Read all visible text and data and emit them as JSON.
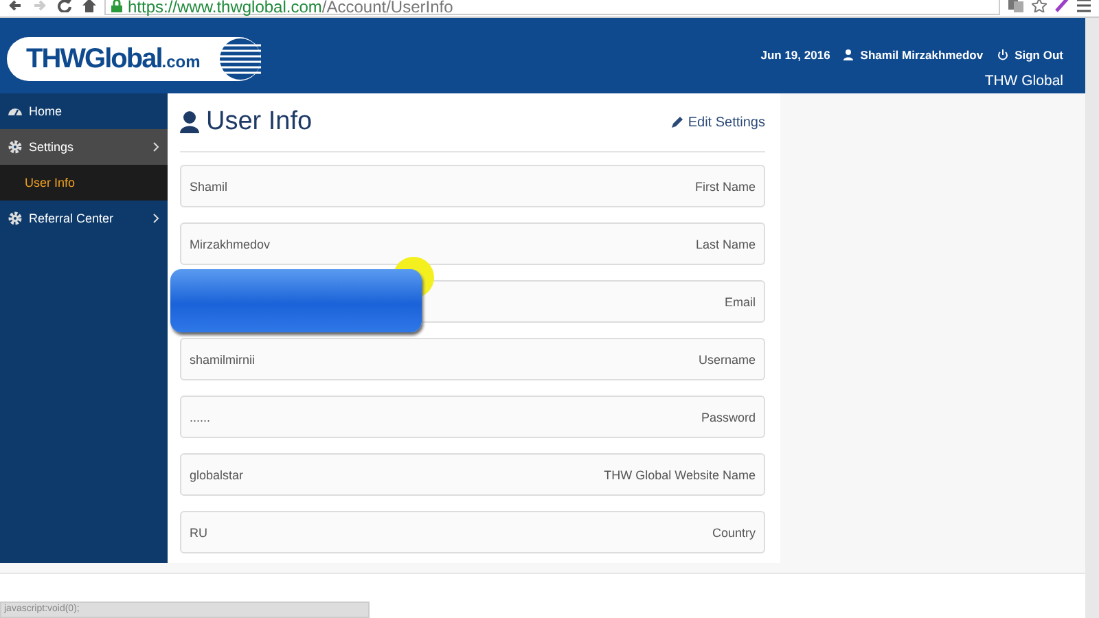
{
  "browser": {
    "url_host": "https://www.thwglobal.com",
    "url_path": "/Account/UserInfo",
    "forward_disabled": true
  },
  "header": {
    "logo": "THWGlobal",
    "logo_suffix": ".com",
    "date": "Jun 19, 2016",
    "user": "Shamil Mirzakhmedov",
    "sign_out": "Sign Out",
    "site_name": "THW Global"
  },
  "sidebar": {
    "items": [
      {
        "label": "Home",
        "kind": "link",
        "expanded": false
      },
      {
        "label": "Settings",
        "kind": "group",
        "expanded": true,
        "children": [
          {
            "label": "User Info",
            "selected": true
          }
        ]
      },
      {
        "label": "Referral Center",
        "kind": "group",
        "expanded": false
      }
    ]
  },
  "panel": {
    "title": "User Info",
    "edit": "Edit Settings",
    "fields": [
      {
        "value": "Shamil",
        "label": "First Name",
        "redacted": false
      },
      {
        "value": "Mirzakhmedov",
        "label": "Last Name",
        "redacted": false
      },
      {
        "label": "Email",
        "redacted": true
      },
      {
        "value": "shamilmirnii",
        "label": "Username",
        "redacted": false
      },
      {
        "value": "......",
        "label": "Password",
        "redacted": false
      },
      {
        "value": "globalstar",
        "label": "THW Global Website Name",
        "redacted": false
      },
      {
        "value": "RU",
        "label": "Country",
        "redacted": false
      }
    ]
  },
  "status_bar": {
    "text": "javascript:void(0);"
  }
}
